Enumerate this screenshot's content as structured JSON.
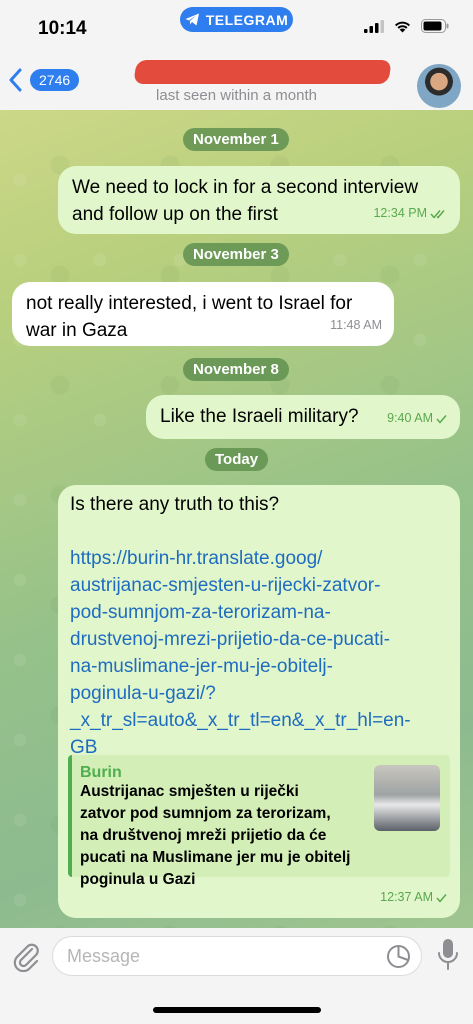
{
  "status_bar": {
    "time": "10:14",
    "app_pill": "TELEGRAM"
  },
  "header": {
    "back_count": "2746",
    "subtitle": "last seen within a month"
  },
  "dates": {
    "d1": "November 1",
    "d2": "November 3",
    "d3": "November 8",
    "d4": "Today"
  },
  "messages": [
    {
      "direction": "out",
      "lines": [
        "We need to lock in for a second interview",
        "and follow up on the first"
      ],
      "time": "12:34 PM"
    },
    {
      "direction": "in",
      "lines": [
        "not really interested, i went to Israel for",
        "war in Gaza"
      ],
      "time": "11:48 AM"
    },
    {
      "direction": "out",
      "lines": [
        "Like the Israeli military?"
      ],
      "time": "9:40 AM"
    },
    {
      "direction": "out",
      "text": "Is there any truth to this?",
      "link_lines": [
        "https://burin-hr.translate.goog/",
        "austrijanac-smjesten-u-rijecki-zatvor-",
        "pod-sumnjom-za-terorizam-na-",
        "drustvenoj-mrezi-prijetio-da-ce-pucati-",
        "na-muslimane-jer-mu-je-obitelj-",
        "poginula-u-gazi/?",
        "_x_tr_sl=auto&_x_tr_tl=en&_x_tr_hl=en-",
        "GB"
      ],
      "preview": {
        "site": "Burin",
        "desc_lines": [
          "Austrijanac smješten u riječki",
          "zatvor pod sumnjom za terorizam,",
          "na društvenoj mreži prijetio da će",
          "pucati na Muslimane jer mu je obitelj",
          "poginula u Gazi"
        ]
      },
      "time": "12:37 AM"
    }
  ],
  "input": {
    "placeholder": "Message"
  },
  "colors": {
    "accent": "#2f7ef0",
    "out_bubble": "#e1f7cb",
    "in_bubble": "#ffffff",
    "check": "#5aa84f"
  }
}
